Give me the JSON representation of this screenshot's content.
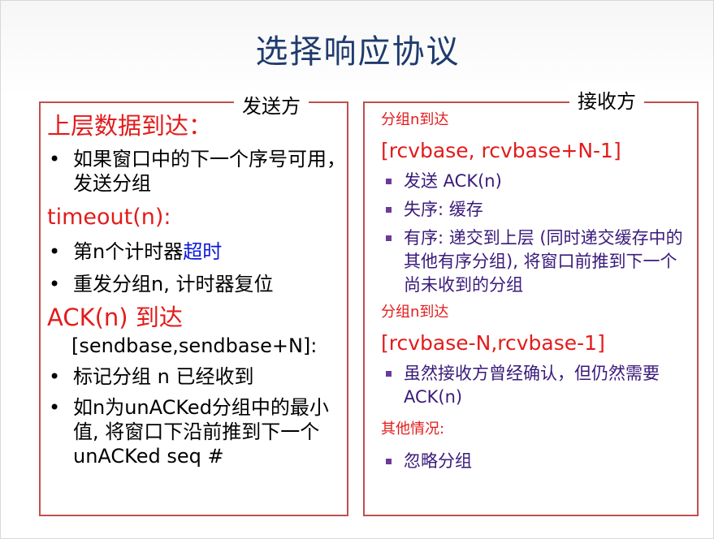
{
  "title": "选择响应协议",
  "sender": {
    "legend": "发送方",
    "sections": {
      "upper_data": "上层数据到达：",
      "upper_item": "如果窗口中的下一个序号可用，发送分组",
      "timeout_head": "timeout(n):",
      "timeout_item1_prefix": "第n个计时器",
      "timeout_item1_highlight": "超时",
      "timeout_item2": "重发分组n, 计时器复位",
      "ack_head": "ACK(n) 到达",
      "ack_range": "[sendbase,sendbase+N]:",
      "ack_item1": "标记分组 n 已经收到",
      "ack_item2": "如n为unACKed分组中的最小值, 将窗口下沿前推到下一个unACKed seq #"
    }
  },
  "receiver": {
    "legend": "接收方",
    "block1_head": "分组n到达",
    "block1_range": "[rcvbase, rcvbase+N-1]",
    "block1_items": [
      "发送 ACK(n)",
      "失序: 缓存",
      "有序: 递交到上层 (同时递交缓存中的其他有序分组), 将窗口前推到下一个尚未收到的分组"
    ],
    "block2_head": "分组n到达",
    "block2_range": "[rcvbase-N,rcvbase-1]",
    "block2_items": [
      "虽然接收方曾经确认，但仍然需要ACK(n)"
    ],
    "block3_head": "其他情况:",
    "block3_items": [
      "忽略分组"
    ]
  },
  "colors": {
    "title": "#1f3b6e",
    "border": "#c0504d",
    "red": "#e31b1b",
    "purple": "#3a1a7a",
    "blue": "#0a19d8"
  }
}
